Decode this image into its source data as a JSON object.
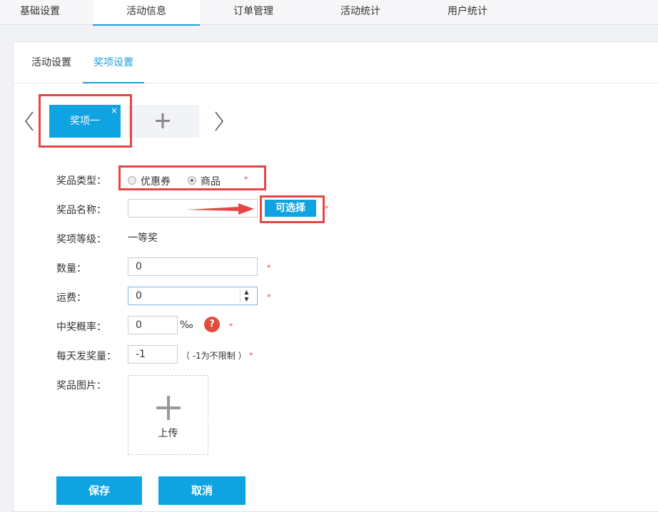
{
  "top_tabs": [
    "基础设置",
    "活动信息",
    "订单管理",
    "活动统计",
    "用户统计"
  ],
  "sub_tabs": [
    "活动设置",
    "奖项设置"
  ],
  "prize_tabs": {
    "current": "奖项一",
    "close": "×",
    "add": "+"
  },
  "form": {
    "prize_type": {
      "label": "奖品类型：",
      "options": [
        "优惠券",
        "商品"
      ],
      "selected": "商品"
    },
    "prize_name": {
      "label": "奖品名称：",
      "value": "",
      "button": "可选择"
    },
    "prize_level": {
      "label": "奖项等级：",
      "value": "一等奖"
    },
    "quantity": {
      "label": "数量：",
      "value": "0"
    },
    "shipping": {
      "label": "运费：",
      "value": "0"
    },
    "probability": {
      "label": "中奖概率：",
      "value": "0",
      "unit": "‰",
      "help": "?"
    },
    "daily_limit": {
      "label": "每天发奖量：",
      "value": "-1",
      "hint": "（ -1为不限制 ）"
    },
    "prize_image": {
      "label": "奖品图片：",
      "upload_label": "上传"
    },
    "required_mark": "*"
  },
  "actions": {
    "save": "保存",
    "cancel": "取消"
  },
  "colors": {
    "accent": "#10a3e2",
    "highlight": "#e64545",
    "help": "#e54b3c"
  }
}
